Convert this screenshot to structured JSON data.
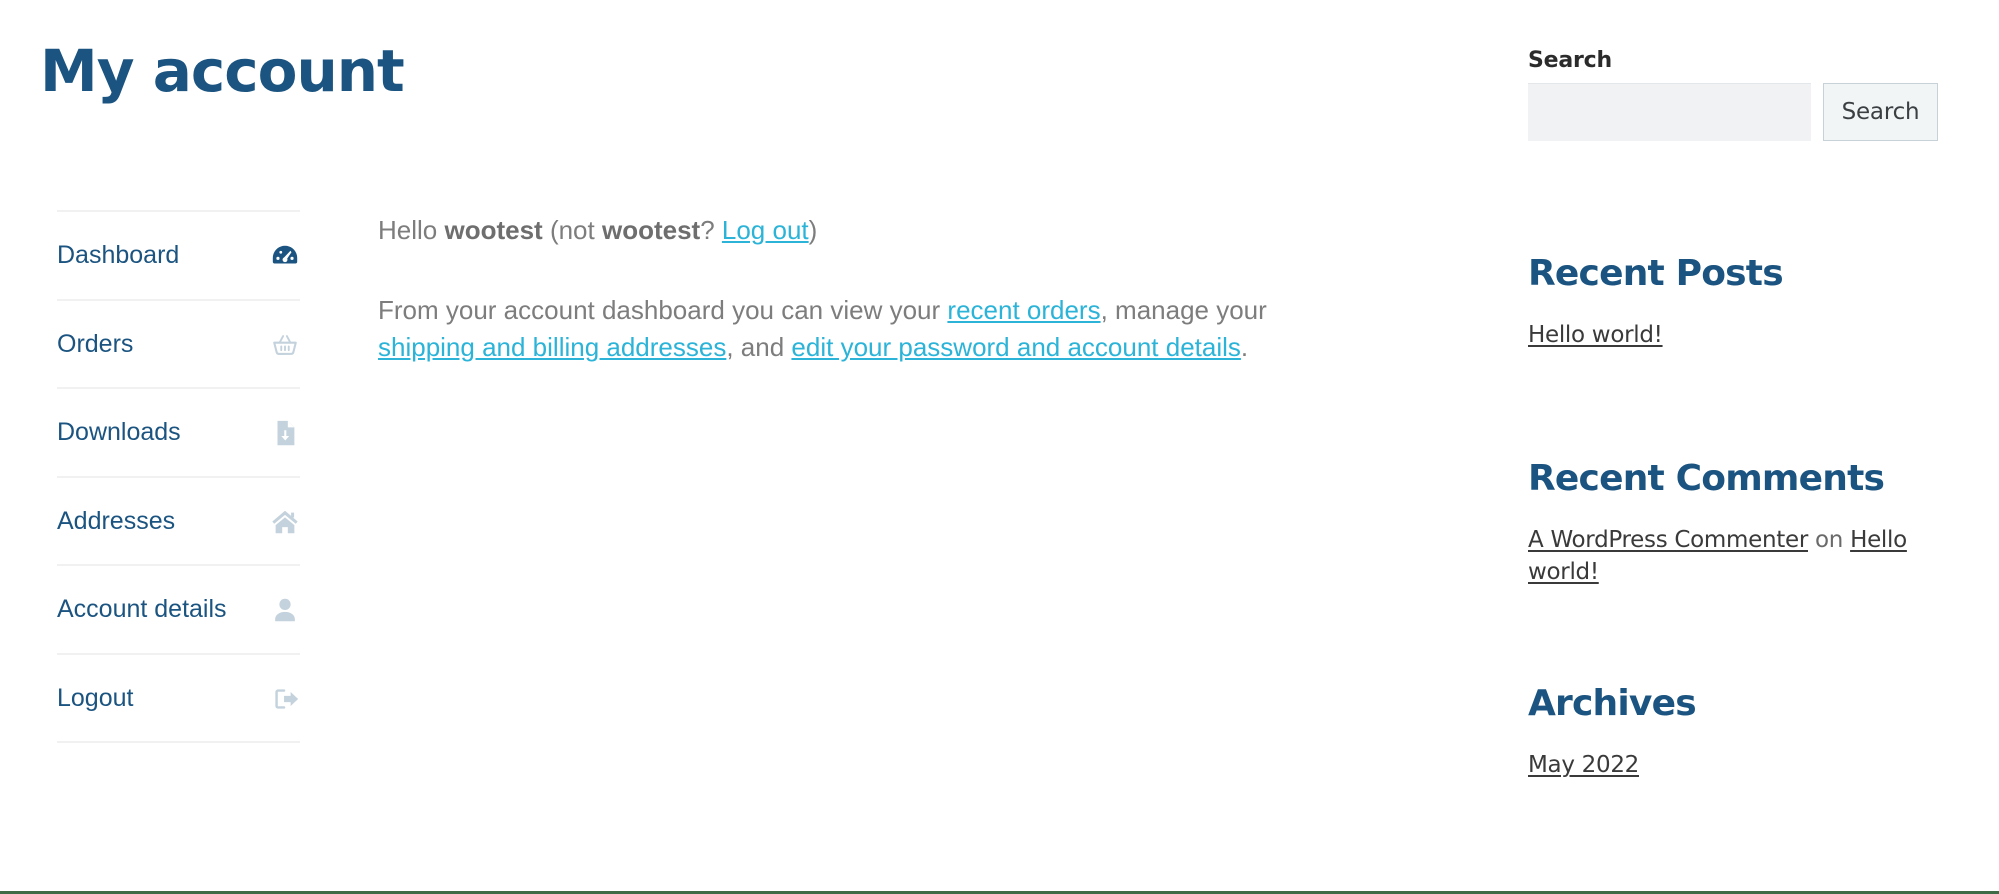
{
  "page": {
    "title": "My account"
  },
  "account_nav": {
    "items": [
      {
        "label": "Dashboard",
        "icon": "dashboard-gauge-icon"
      },
      {
        "label": "Orders",
        "icon": "shopping-basket-icon"
      },
      {
        "label": "Downloads",
        "icon": "download-file-icon"
      },
      {
        "label": "Addresses",
        "icon": "home-icon"
      },
      {
        "label": "Account details",
        "icon": "user-icon"
      },
      {
        "label": "Logout",
        "icon": "sign-out-icon"
      }
    ]
  },
  "main": {
    "greeting": {
      "hello": "Hello ",
      "username": "wootest",
      "not_prefix": " (not ",
      "not_username": "wootest",
      "question": "? ",
      "logout_link": "Log out",
      "close": ")"
    },
    "intro": {
      "part1": "From your account dashboard you can view your ",
      "link_orders": "recent orders",
      "part2": ", manage your ",
      "link_addresses": "shipping and billing addresses",
      "part3": ", and ",
      "link_details": "edit your password and account details",
      "part4": "."
    }
  },
  "sidebar": {
    "search": {
      "label": "Search",
      "value": "",
      "placeholder": "",
      "button_label": "Search"
    },
    "recent_posts": {
      "title": "Recent Posts",
      "items": [
        {
          "label": "Hello world!"
        }
      ]
    },
    "recent_comments": {
      "title": "Recent Comments",
      "items": [
        {
          "author": "A WordPress Commenter",
          "separator": " on ",
          "post": "Hello world!"
        }
      ]
    },
    "archives": {
      "title": "Archives",
      "items": [
        {
          "label": "May 2022"
        }
      ]
    }
  },
  "colors": {
    "heading_blue": "#1b5480",
    "link_cyan": "#2bb3d8",
    "body_gray": "#7d7d7d",
    "icon_muted": "#c3d2dc",
    "icon_active": "#1b5480",
    "footer_border": "#3d6b45"
  }
}
